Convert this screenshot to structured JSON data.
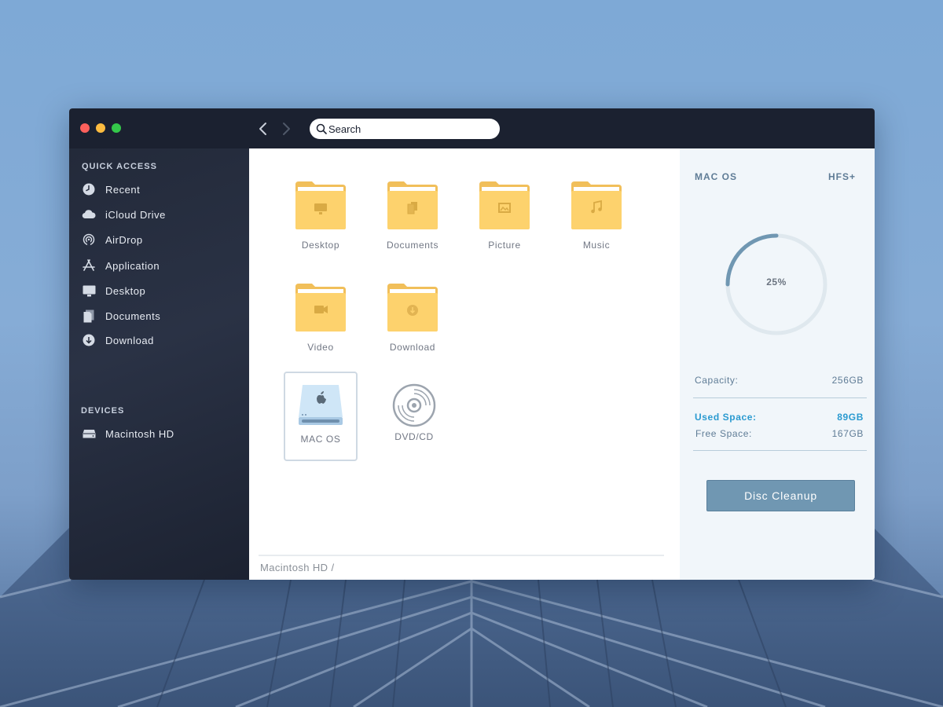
{
  "window": {
    "search_placeholder": "Search"
  },
  "sidebar": {
    "quick_access_heading": "QUICK ACCESS",
    "quick_access": [
      {
        "label": "Recent",
        "icon": "clock-icon"
      },
      {
        "label": "iCloud Drive",
        "icon": "cloud-icon"
      },
      {
        "label": "AirDrop",
        "icon": "airdrop-icon"
      },
      {
        "label": "Application",
        "icon": "app-store-icon"
      },
      {
        "label": "Desktop",
        "icon": "monitor-icon"
      },
      {
        "label": "Documents",
        "icon": "documents-icon"
      },
      {
        "label": "Download",
        "icon": "download-icon"
      }
    ],
    "devices_heading": "DEVICES",
    "devices": [
      {
        "label": "Macintosh HD",
        "icon": "hard-drive-icon"
      }
    ]
  },
  "content": {
    "items": [
      {
        "name": "Desktop",
        "icon": "monitor-icon"
      },
      {
        "name": "Documents",
        "icon": "documents-icon"
      },
      {
        "name": "Picture",
        "icon": "image-icon"
      },
      {
        "name": "Music",
        "icon": "music-note-icon"
      },
      {
        "name": "Video",
        "icon": "video-camera-icon"
      },
      {
        "name": "Download",
        "icon": "download-icon"
      },
      {
        "name": "MAC OS",
        "icon": "apple-drive-icon",
        "selected": true
      },
      {
        "name": "DVD/CD",
        "icon": "disc-icon"
      }
    ],
    "path": "Macintosh HD /"
  },
  "info_panel": {
    "disk_name": "MAC OS",
    "file_system": "HFS+",
    "usage_fraction": 0.25,
    "usage_label": "25%",
    "capacity_label": "Capacity:",
    "capacity_value": "256GB",
    "used_label": "Used Space:",
    "used_value": "89GB",
    "free_label": "Free Space:",
    "free_value": "167GB",
    "cleanup_button": "Disc Cleanup"
  },
  "colors": {
    "titlebar": "#1b2130",
    "accent": "#2a9ad0",
    "folder": "#fdd26d",
    "ring_track": "#dfe8ee",
    "ring_fill": "#7097b2"
  }
}
